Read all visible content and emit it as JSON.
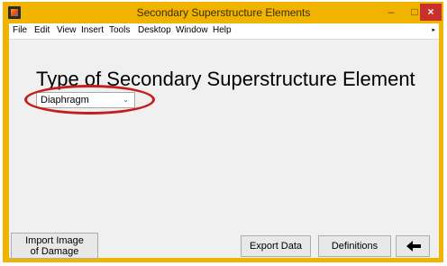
{
  "window": {
    "title": "Secondary Superstructure Elements",
    "controls": {
      "minimize": "–",
      "maximize": "□",
      "close": "×"
    }
  },
  "menubar": {
    "items": [
      "File",
      "Edit",
      "View",
      "Insert",
      "Tools",
      "Desktop",
      "Window",
      "Help"
    ],
    "overflow": "▸"
  },
  "main": {
    "heading": "Type of Secondary Superstructure Element",
    "element_type": {
      "selected": "Diaphragm",
      "arrow": "⌄"
    },
    "highlight_color": "#c41e1e"
  },
  "buttons": {
    "import_line1": "Import Image",
    "import_line2": "of Damage",
    "export": "Export Data",
    "definitions": "Definitions",
    "back_icon": "back-arrow-icon"
  },
  "colors": {
    "frame": "#f0b400",
    "close": "#c9302c",
    "client": "#f0f0f0"
  }
}
